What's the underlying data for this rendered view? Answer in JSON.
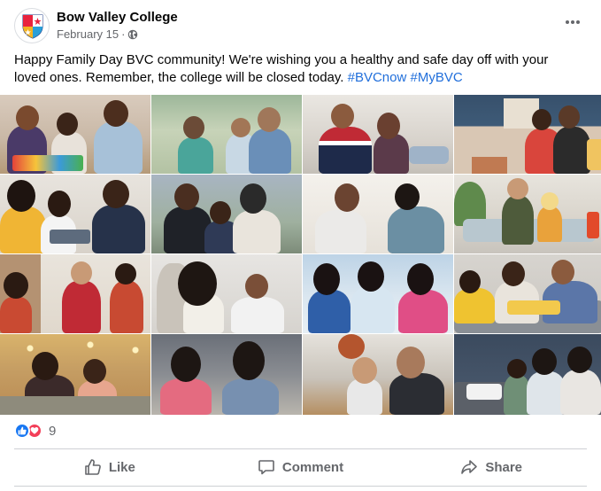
{
  "post": {
    "page_name": "Bow Valley College",
    "date": "February 15",
    "separator": "·",
    "privacy_icon": "globe-icon",
    "more_icon": "more-options-icon",
    "message": {
      "text": "Happy Family Day BVC community! We're wishing you a healthy and safe day off with your loved ones. Remember, the college will be closed today. ",
      "hashtags": [
        "#BVCnow",
        "#MyBVC"
      ]
    },
    "photos_count": 16,
    "reactions": {
      "icons": [
        "like-reaction-icon",
        "love-reaction-icon"
      ],
      "count": "9"
    },
    "actions": {
      "like_label": "Like",
      "comment_label": "Comment",
      "share_label": "Share"
    }
  },
  "colors": {
    "text_primary": "#050505",
    "text_secondary": "#65676b",
    "hashtag": "#216fdb",
    "like_blue": "#1877f2",
    "love_red": "#f33e58",
    "divider": "#ced0d4"
  }
}
